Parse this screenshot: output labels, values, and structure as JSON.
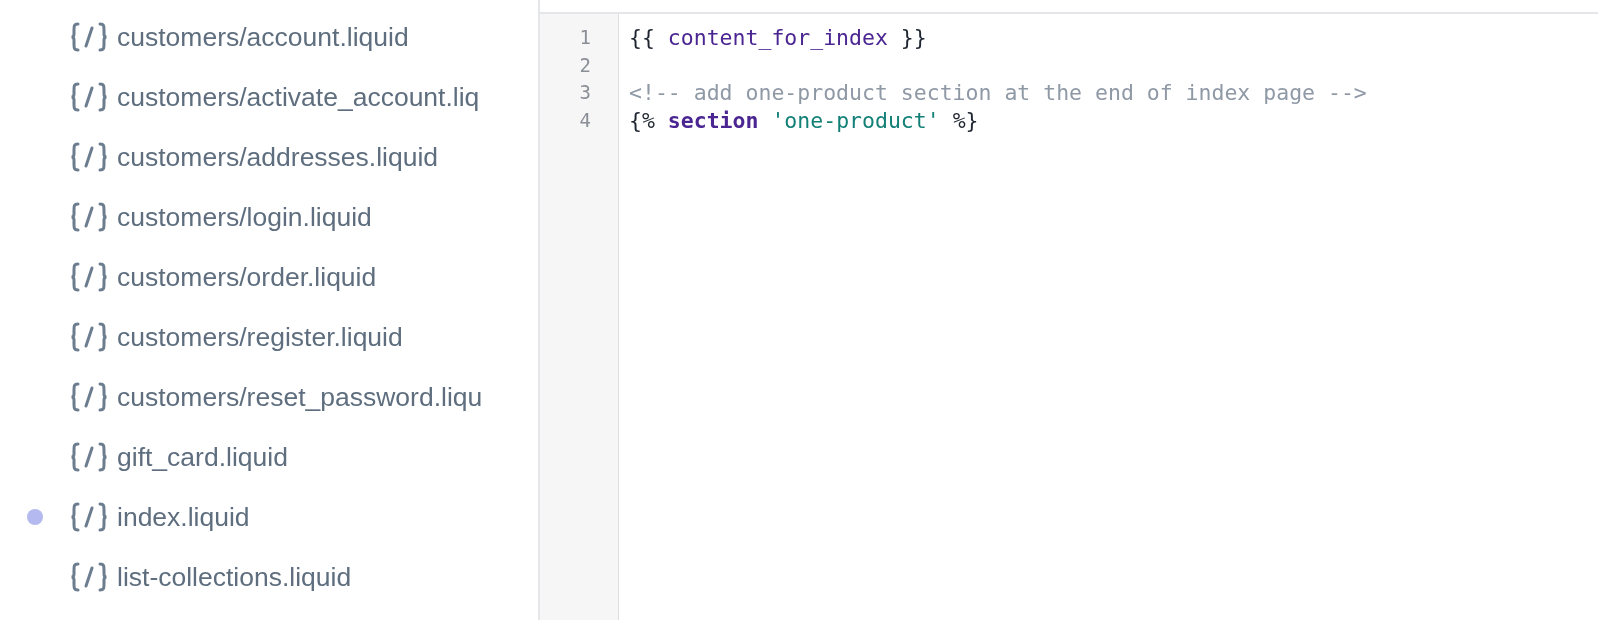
{
  "files": [
    {
      "name": "customers/account.liquid",
      "modified": false
    },
    {
      "name": "customers/activate_account.liq",
      "modified": false
    },
    {
      "name": "customers/addresses.liquid",
      "modified": false
    },
    {
      "name": "customers/login.liquid",
      "modified": false
    },
    {
      "name": "customers/order.liquid",
      "modified": false
    },
    {
      "name": "customers/register.liquid",
      "modified": false
    },
    {
      "name": "customers/reset_password.liqu",
      "modified": false
    },
    {
      "name": "gift_card.liquid",
      "modified": false
    },
    {
      "name": "index.liquid",
      "modified": true
    },
    {
      "name": "list-collections.liquid",
      "modified": false
    }
  ],
  "editor": {
    "lines": [
      {
        "number": "1",
        "tokens": [
          {
            "kind": "plain",
            "text": "{{ "
          },
          {
            "kind": "variable",
            "text": "content_for_index"
          },
          {
            "kind": "plain",
            "text": " }}"
          }
        ]
      },
      {
        "number": "2"
      },
      {
        "number": "3",
        "tokens": [
          {
            "kind": "comment",
            "text": "<!-- add one-product section at the end of index page -->"
          }
        ]
      },
      {
        "number": "4",
        "tokens": [
          {
            "kind": "plain",
            "text": "{% "
          },
          {
            "kind": "keyword",
            "text": "section "
          },
          {
            "kind": "string",
            "text": "'one-product'"
          },
          {
            "kind": "plain",
            "text": " %}"
          }
        ]
      }
    ]
  }
}
